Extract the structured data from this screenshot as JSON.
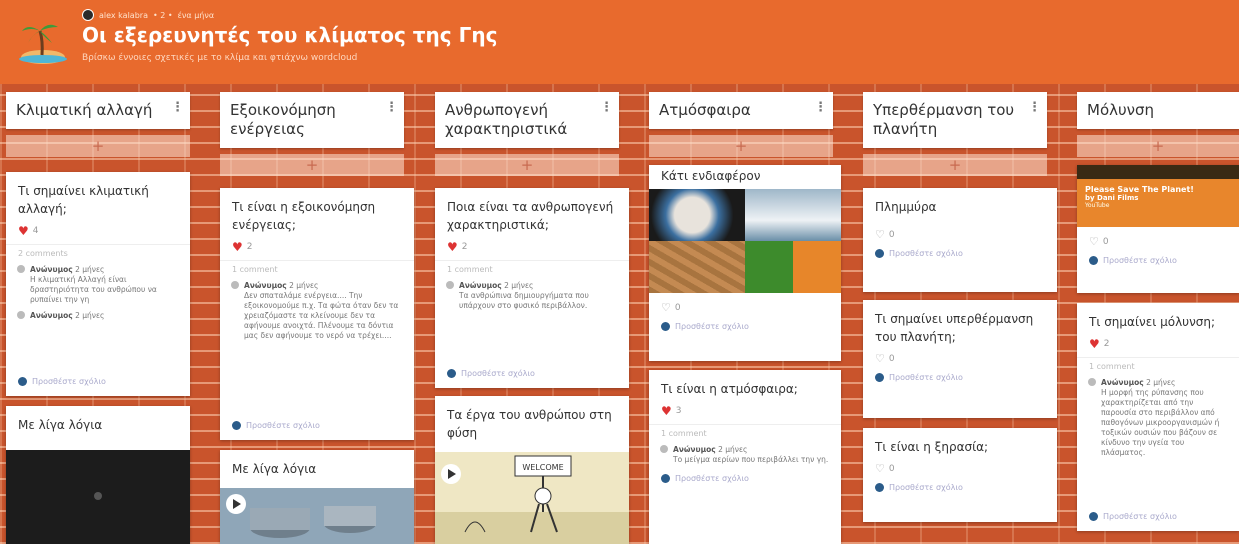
{
  "header": {
    "user": "alex kalabra",
    "meta_sep": "• 2 •",
    "time": "ένα μήνα",
    "title": "Οι εξερευνητές του κλίματος της Γης",
    "subtitle": "Βρίσκω έννοιες σχετικές με το κλίμα και φτιάχνω wordcloud"
  },
  "add_symbol": "+",
  "columns": [
    {
      "title": "Κλιματική αλλαγή"
    },
    {
      "title": "Εξοικονόμηση ενέργειας"
    },
    {
      "title": "Ανθρωπογενή χαρακτηριστικά"
    },
    {
      "title": "Ατμόσφαιρα"
    },
    {
      "title": "Υπερθέρμανση του πλανήτη"
    },
    {
      "title": "Μόλυνση"
    }
  ],
  "cards": {
    "c1a": {
      "title": "Τι σημαίνει κλιματική αλλαγή;",
      "likes": "4",
      "count": "2 comments",
      "comments": [
        {
          "author": "Ανώνυμος",
          "time": "2 μήνες",
          "text": "Η κλιματική Αλλαγή είναι δραστηριότητα του ανθρώπου να ρυπαίνει την γη"
        },
        {
          "author": "Ανώνυμος",
          "time": "2 μήνες",
          "text": ""
        }
      ],
      "add": "Προσθέστε σχόλιο"
    },
    "c1b": {
      "title": "Με λίγα λόγια"
    },
    "c2a": {
      "title": "Τι είναι η εξοικονόμηση ενέργειας;",
      "likes": "2",
      "count": "1 comment",
      "comments": [
        {
          "author": "Ανώνυμος",
          "time": "2 μήνες",
          "text": "Δεν σπαταλάμε ενέργεια.... Την εξοικονομούμε π.χ. Τα φώτα όταν δεν τα χρειαζόμαστε τα κλείνουμε δεν τα αφήνουμε ανοιχτά. Πλένουμε τα δόντια μας δεν αφήνουμε το νερό να τρέχει...."
        }
      ],
      "add": "Προσθέστε σχόλιο"
    },
    "c2b": {
      "title": "Με λίγα λόγια"
    },
    "c3a": {
      "title": "Ποια είναι τα ανθρωπογενή χαρακτηριστικά;",
      "likes": "2",
      "count": "1 comment",
      "comments": [
        {
          "author": "Ανώνυμος",
          "time": "2 μήνες",
          "text": "Τα ανθρώπινα δημιουργήματα που υπάρχουν στο φυσικό περιβάλλον."
        }
      ],
      "add": "Προσθέστε σχόλιο"
    },
    "c3b": {
      "title": "Τα έργα του ανθρώπου στη φύση",
      "sign_text": "WELCOME"
    },
    "c4a": {
      "title": "Κάτι ενδιαφέρον",
      "likes": "0",
      "add": "Προσθέστε σχόλιο"
    },
    "c4b": {
      "title": "Τι είναι η ατμόσφαιρα;",
      "likes": "3",
      "count": "1 comment",
      "comments": [
        {
          "author": "Ανώνυμος",
          "time": "2 μήνες",
          "text": "Το μείγμα αερίων που περιβάλλει την γη."
        }
      ],
      "add": "Προσθέστε σχόλιο"
    },
    "c5a": {
      "title": "Πλημμύρα",
      "likes": "0",
      "add": "Προσθέστε σχόλιο"
    },
    "c5b": {
      "title": "Τι σημαίνει υπερθέρμανση του πλανήτη;",
      "likes": "0",
      "add": "Προσθέστε σχόλιο"
    },
    "c5c": {
      "title": "Τι είναι η ξηρασία;",
      "likes": "0",
      "add": "Προσθέστε σχόλιο"
    },
    "c6a": {
      "video_title": "Please Save The Planet!",
      "video_by": "by Dani Films",
      "video_src": "YouTube",
      "likes": "0",
      "add": "Προσθέστε σχόλιο"
    },
    "c6b": {
      "title": "Τι σημαίνει μόλυνση;",
      "likes": "2",
      "count": "1 comment",
      "comments": [
        {
          "author": "Ανώνυμος",
          "time": "2 μήνες",
          "text": "Η μορφή της ρύπανσης που χαρακτηρίζεται από την παρουσία στο περιβάλλον από παθογόνων μικροοργανισμών ή τοξικών ουσιών που βάζουν σε κίνδυνο την υγεία του πλάσματος."
        }
      ],
      "add": "Προσθέστε σχόλιο"
    }
  },
  "colors": {
    "header": "#e86a2d",
    "wall": "#c9542c",
    "heart": "#dd3333"
  }
}
